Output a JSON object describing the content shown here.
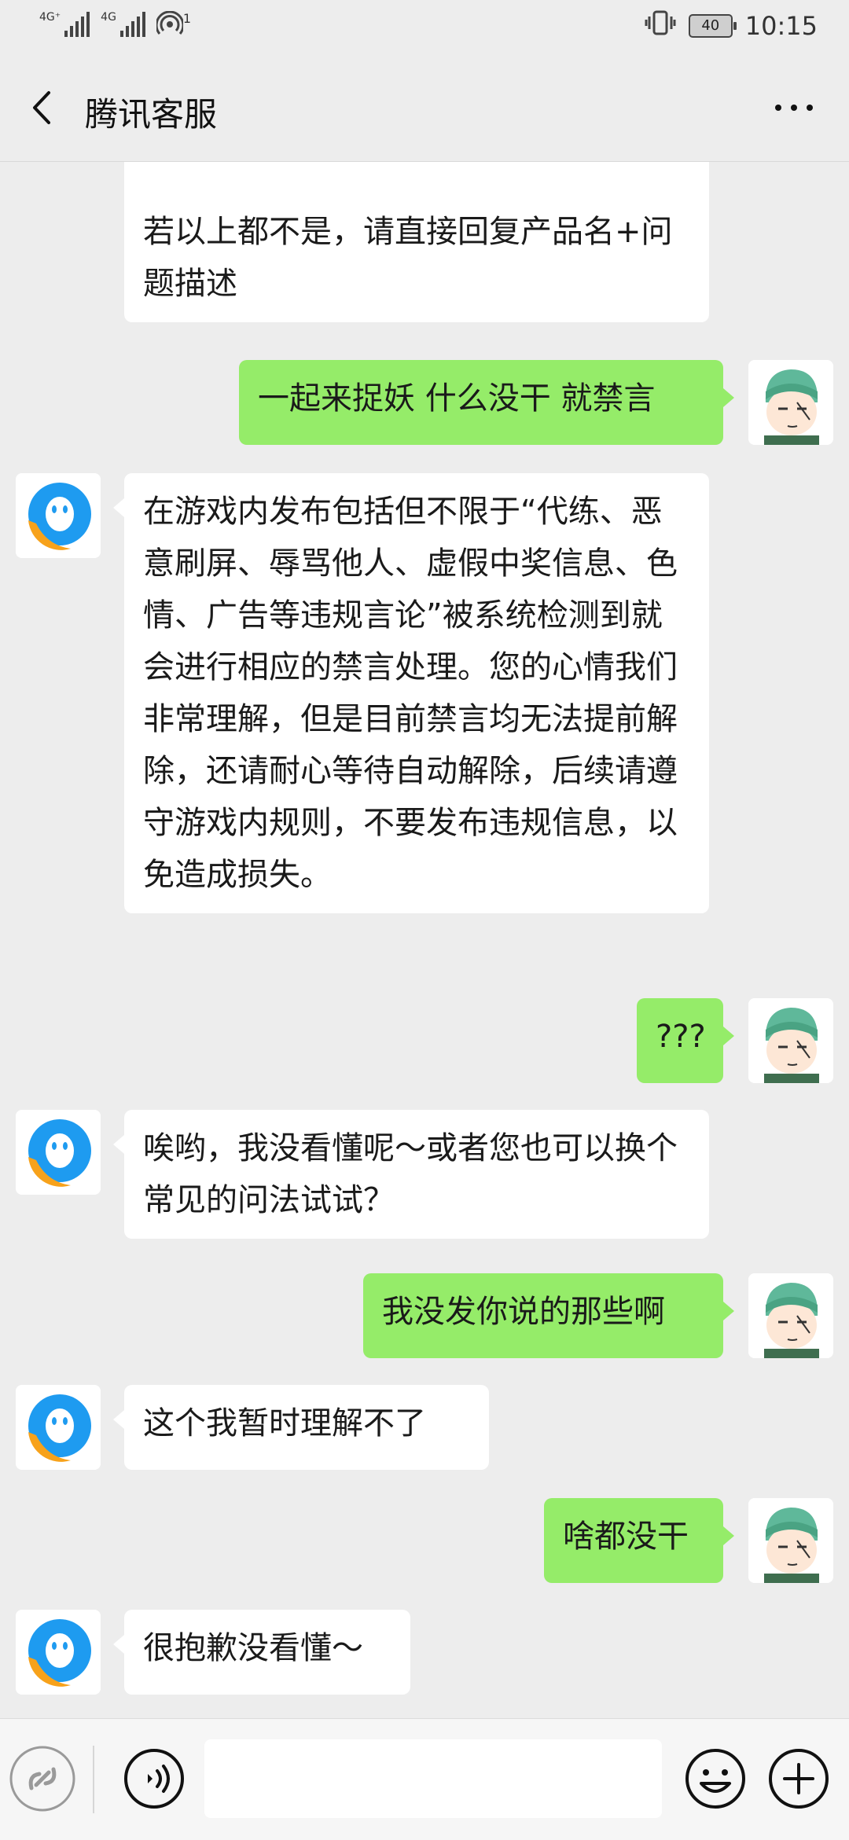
{
  "status_bar": {
    "signal1_tag": "4G⁺",
    "signal2_tag": "4G",
    "hotspot_count": "1",
    "battery_level": "40",
    "time": "10:15"
  },
  "header": {
    "title": "腾讯客服"
  },
  "messages": [
    {
      "side": "in",
      "text": "若以上都不是，请直接回复产品名+问题描述"
    },
    {
      "side": "out",
      "text": "一起来捉妖 什么没干 就禁言"
    },
    {
      "side": "in",
      "text": "在游戏内发布包括但不限于“代练、恶意刷屏、辱骂他人、虚假中奖信息、色情、广告等违规言论”被系统检测到就会进行相应的禁言处理。您的心情我们非常理解，但是目前禁言均无法提前解除，还请耐心等待自动解除，后续请遵守游戏内规则，不要发布违规信息，以免造成损失。"
    },
    {
      "side": "out",
      "text": "???"
    },
    {
      "side": "in",
      "text": "唉哟，我没看懂呢～或者您也可以换个常见的问法试试？"
    },
    {
      "side": "out",
      "text": "我没发你说的那些啊"
    },
    {
      "side": "in",
      "text": "这个我暂时理解不了"
    },
    {
      "side": "out",
      "text": "啥都没干"
    },
    {
      "side": "in",
      "text": "很抱歉没看懂～"
    }
  ],
  "input_bar": {
    "value": "",
    "icons": [
      "mini-program-icon",
      "voice-icon",
      "emoji-icon",
      "add-icon"
    ]
  },
  "colors": {
    "background": "#ededed",
    "outgoing_bubble": "#95ec69",
    "incoming_bubble": "#ffffff",
    "bot_avatar_blue": "#1e9bf0",
    "bot_avatar_orange": "#f7a21b"
  }
}
